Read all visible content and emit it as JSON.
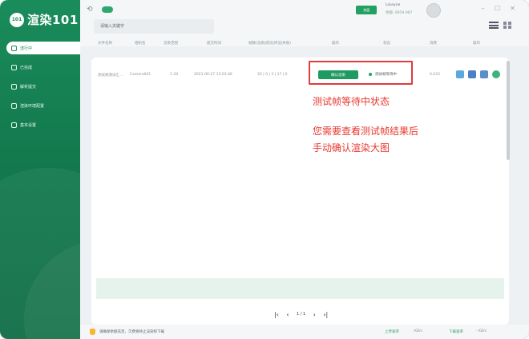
{
  "app": {
    "logo_mark": "101",
    "logo_text": "渲染101"
  },
  "sidebar": {
    "items": [
      {
        "label": "渲行中",
        "active": true
      },
      {
        "label": "已完成"
      },
      {
        "label": "解析提交"
      },
      {
        "label": "渲染环境配置"
      },
      {
        "label": "基本设置"
      }
    ]
  },
  "topbar": {
    "search_placeholder": "请输入关键字",
    "recharge_label": "充值",
    "user_name": "LsLeyne",
    "user_balance": "余额: 8959.987",
    "minimize": "–",
    "maximize": "☐",
    "close": "✕"
  },
  "table": {
    "columns": [
      "文件名称",
      "相机名",
      "渲染范围",
      "提交时间",
      "帧数(渲染|成功|待渲|失败)",
      "操作",
      "状态",
      "消费",
      "操作"
    ],
    "rows": [
      {
        "file_name": "测试帧测试汇...",
        "camera": "Camera001",
        "range": "1-20",
        "submit_time": "2021-06-27 15:03:46",
        "frames": "20 | 0 | 3 | 17 | 0",
        "action_button": "确认渲染",
        "status": "测试帧等待中",
        "cost": "0.033"
      }
    ]
  },
  "annotation": {
    "line1": "测试帧等待中状态",
    "line2": "您需要查看测试帧结果后",
    "line3": "手动确认渲染大图"
  },
  "pager": {
    "first": "|‹",
    "prev": "‹",
    "page_text": "1 / 1",
    "next": "›",
    "last": "›|"
  },
  "statusbar": {
    "tip": "请确保余额充足，欠费将终止渲染和下载",
    "upload_label": "上传速率",
    "upload_value": "- KB/s",
    "download_label": "下载速率",
    "download_value": "- KB/s"
  },
  "colors": {
    "brand_green": "#1a8c5b",
    "annotation_red": "#e8382f"
  }
}
